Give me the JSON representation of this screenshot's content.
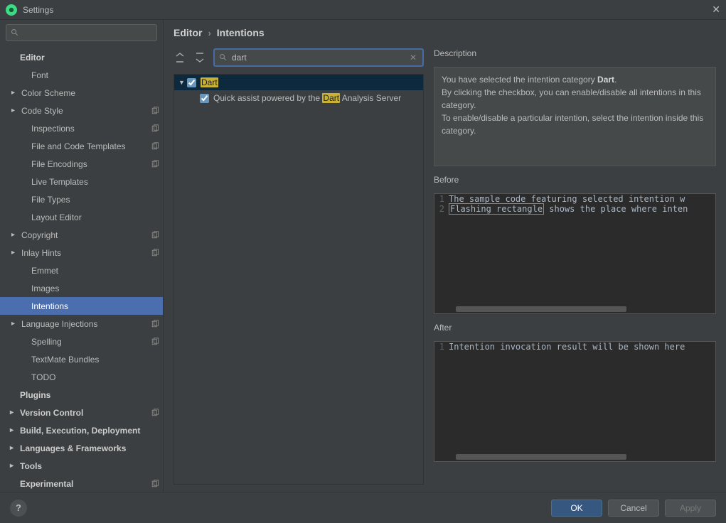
{
  "window": {
    "title": "Settings"
  },
  "sidebar": {
    "items": [
      {
        "label": "Editor",
        "level": 1,
        "caret": false,
        "heading": true
      },
      {
        "label": "Font",
        "level": 2,
        "caret": false
      },
      {
        "label": "Color Scheme",
        "level": 2,
        "caret": true
      },
      {
        "label": "Code Style",
        "level": 2,
        "caret": true,
        "badge": true
      },
      {
        "label": "Inspections",
        "level": 2,
        "caret": false,
        "badge": true
      },
      {
        "label": "File and Code Templates",
        "level": 2,
        "caret": false,
        "badge": true
      },
      {
        "label": "File Encodings",
        "level": 2,
        "caret": false,
        "badge": true
      },
      {
        "label": "Live Templates",
        "level": 2,
        "caret": false
      },
      {
        "label": "File Types",
        "level": 2,
        "caret": false
      },
      {
        "label": "Layout Editor",
        "level": 2,
        "caret": false
      },
      {
        "label": "Copyright",
        "level": 2,
        "caret": true,
        "badge": true
      },
      {
        "label": "Inlay Hints",
        "level": 2,
        "caret": true,
        "badge": true
      },
      {
        "label": "Emmet",
        "level": 2,
        "caret": false
      },
      {
        "label": "Images",
        "level": 2,
        "caret": false
      },
      {
        "label": "Intentions",
        "level": 2,
        "caret": false,
        "selected": true
      },
      {
        "label": "Language Injections",
        "level": 2,
        "caret": true,
        "badge": true
      },
      {
        "label": "Spelling",
        "level": 2,
        "caret": false,
        "badge": true
      },
      {
        "label": "TextMate Bundles",
        "level": 2,
        "caret": false
      },
      {
        "label": "TODO",
        "level": 2,
        "caret": false
      },
      {
        "label": "Plugins",
        "level": 1,
        "caret": false,
        "heading": true
      },
      {
        "label": "Version Control",
        "level": 1,
        "caret": true,
        "badge": true
      },
      {
        "label": "Build, Execution, Deployment",
        "level": 1,
        "caret": true
      },
      {
        "label": "Languages & Frameworks",
        "level": 1,
        "caret": true
      },
      {
        "label": "Tools",
        "level": 1,
        "caret": true
      },
      {
        "label": "Experimental",
        "level": 1,
        "caret": false,
        "badge": true,
        "heading": true
      }
    ]
  },
  "breadcrumb": {
    "root": "Editor",
    "child": "Intentions"
  },
  "search": {
    "value": "dart",
    "placeholder": ""
  },
  "intentions_tree": {
    "group": {
      "name": "Dart",
      "hl": "Dart",
      "checked": true
    },
    "child": {
      "checked": true,
      "pre": "Quick assist powered by the ",
      "hl": "Dart",
      "post": " Analysis Server"
    }
  },
  "description": {
    "title": "Description",
    "line1_pre": "You have selected the intention category ",
    "line1_bold": "Dart",
    "line1_post": ".",
    "line2": "By clicking the checkbox, you can enable/disable all intentions in this category.",
    "line3": "To enable/disable a particular intention, select the intention inside this category."
  },
  "before": {
    "title": "Before",
    "lines": [
      {
        "n": "1",
        "txt": "The sample code featuring selected intention w"
      },
      {
        "n": "2",
        "pre": "",
        "boxed": "Flashing rectangle",
        "post": " shows the place where inten"
      }
    ]
  },
  "after": {
    "title": "After",
    "lines": [
      {
        "n": "1",
        "txt": "Intention invocation result will be shown here"
      }
    ]
  },
  "buttons": {
    "ok": "OK",
    "cancel": "Cancel",
    "apply": "Apply"
  }
}
